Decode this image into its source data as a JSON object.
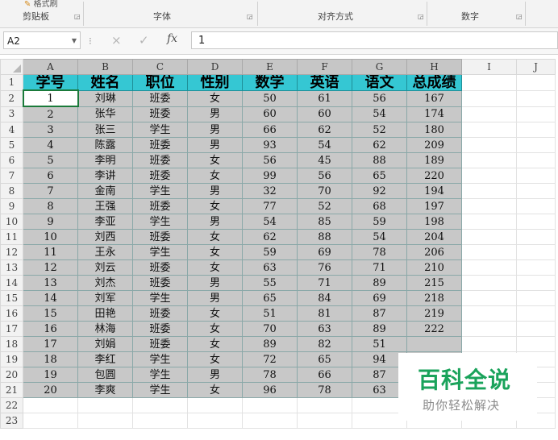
{
  "ribbon": {
    "format_painter_label": "格式刷",
    "groups": [
      "剪贴板",
      "字体",
      "对齐方式",
      "数字"
    ]
  },
  "formula_bar": {
    "cell_ref": "A2",
    "cancel_icon": "×",
    "enter_icon": "✓",
    "fx_icon": "fx",
    "value": "1"
  },
  "sheet": {
    "columns": [
      "A",
      "B",
      "C",
      "D",
      "E",
      "F",
      "G",
      "H",
      "I",
      "J"
    ],
    "header": [
      "学号",
      "姓名",
      "职位",
      "性别",
      "数学",
      "英语",
      "语文",
      "总成绩"
    ],
    "rows": [
      [
        "1",
        "刘琳",
        "班委",
        "女",
        "50",
        "61",
        "56",
        "167"
      ],
      [
        "2",
        "张华",
        "班委",
        "男",
        "60",
        "60",
        "54",
        "174"
      ],
      [
        "3",
        "张三",
        "学生",
        "男",
        "66",
        "62",
        "52",
        "180"
      ],
      [
        "4",
        "陈露",
        "班委",
        "男",
        "93",
        "54",
        "62",
        "209"
      ],
      [
        "5",
        "李明",
        "班委",
        "女",
        "56",
        "45",
        "88",
        "189"
      ],
      [
        "6",
        "李讲",
        "班委",
        "女",
        "99",
        "56",
        "65",
        "220"
      ],
      [
        "7",
        "金南",
        "学生",
        "男",
        "32",
        "70",
        "92",
        "194"
      ],
      [
        "8",
        "王强",
        "班委",
        "女",
        "77",
        "52",
        "68",
        "197"
      ],
      [
        "9",
        "李亚",
        "学生",
        "男",
        "54",
        "85",
        "59",
        "198"
      ],
      [
        "10",
        "刘西",
        "班委",
        "女",
        "62",
        "88",
        "54",
        "204"
      ],
      [
        "11",
        "王永",
        "学生",
        "女",
        "59",
        "69",
        "78",
        "206"
      ],
      [
        "12",
        "刘云",
        "班委",
        "女",
        "63",
        "76",
        "71",
        "210"
      ],
      [
        "13",
        "刘杰",
        "班委",
        "男",
        "55",
        "71",
        "89",
        "215"
      ],
      [
        "14",
        "刘军",
        "学生",
        "男",
        "65",
        "84",
        "69",
        "218"
      ],
      [
        "15",
        "田艳",
        "班委",
        "女",
        "51",
        "81",
        "87",
        "219"
      ],
      [
        "16",
        "林海",
        "班委",
        "女",
        "70",
        "63",
        "89",
        "222"
      ],
      [
        "17",
        "刘娟",
        "班委",
        "女",
        "89",
        "82",
        "51",
        ""
      ],
      [
        "18",
        "李红",
        "学生",
        "女",
        "72",
        "65",
        "94",
        ""
      ],
      [
        "19",
        "包圆",
        "学生",
        "男",
        "78",
        "66",
        "87",
        ""
      ],
      [
        "20",
        "李爽",
        "学生",
        "女",
        "96",
        "78",
        "63",
        ""
      ]
    ],
    "row_numbers": [
      "1",
      "2",
      "3",
      "4",
      "5",
      "6",
      "7",
      "8",
      "9",
      "10",
      "11",
      "12",
      "13",
      "14",
      "15",
      "16",
      "17",
      "18",
      "19",
      "20",
      "21",
      "22",
      "23"
    ]
  },
  "watermark": {
    "title": "百科全说",
    "subtitle": "助你轻松解决"
  },
  "colors": {
    "header_fill": "#35c7d3",
    "data_fill": "#c8c8c8",
    "watermark_green": "#1aa35b"
  }
}
